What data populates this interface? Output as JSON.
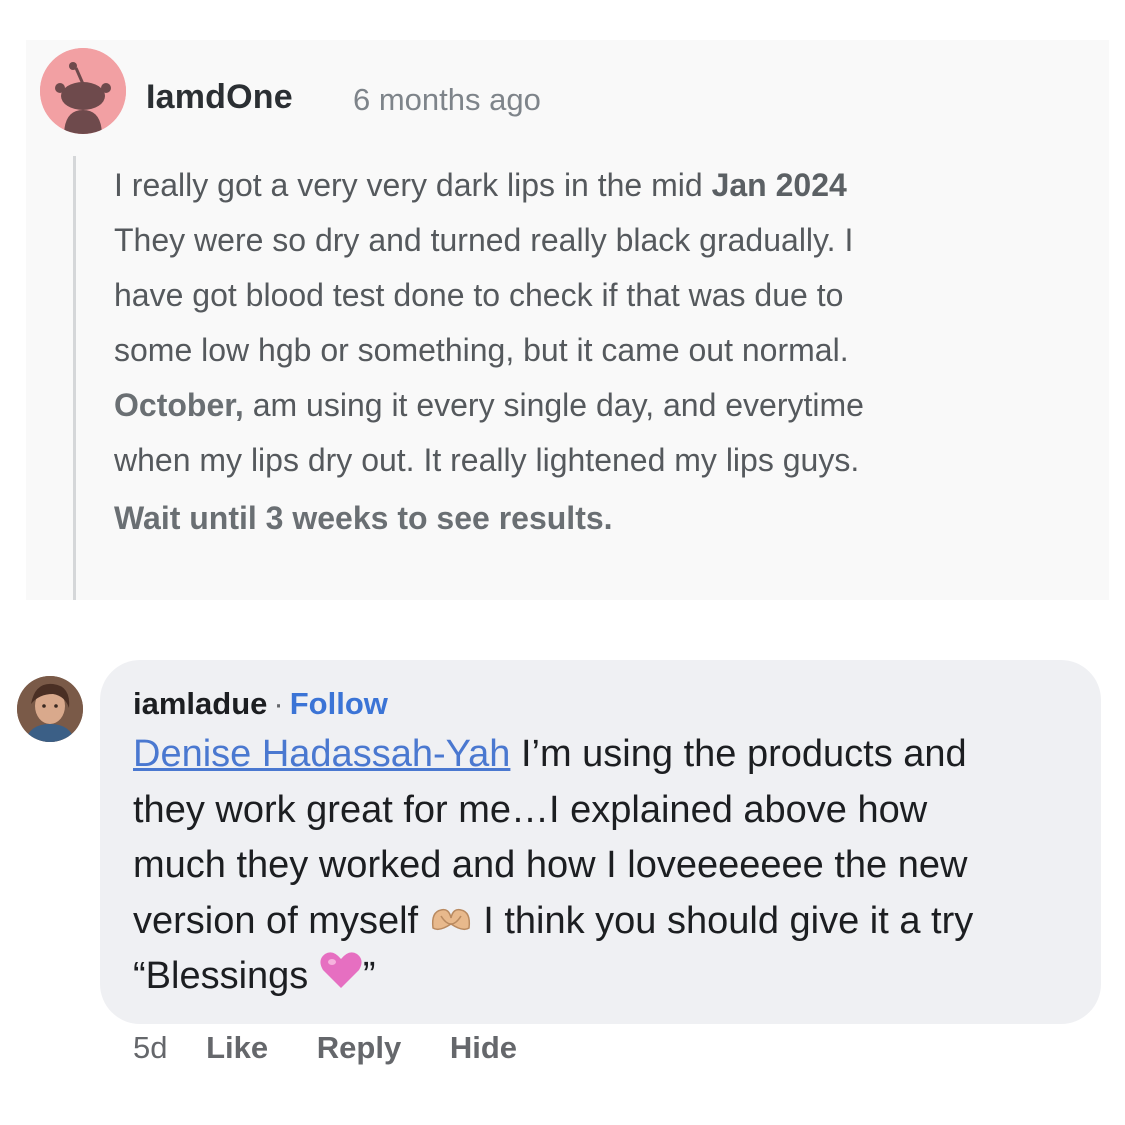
{
  "comment1": {
    "username": "IamdOne",
    "timestamp": "6 months ago",
    "lines": [
      "I really got a very very dark lips in the mid ",
      "They were so dry and turned really black gradually. I",
      "have got blood test done to check if that was due to",
      "some low hgb or something, but it came out normal.",
      " am using it every single day, and everytime",
      "when my lips dry out. It really lightened my lips guys.",
      "Wait until 3 weeks to see results."
    ],
    "date_overlay": "Jan 2024",
    "month_overlay": "October,",
    "avatar_icon": "reddit-snoo-avatar-icon",
    "colors": {
      "card_bg": "#f9f9f9",
      "avatar_bg": "#f2a0a3",
      "avatar_fg": "#6e4a4c"
    }
  },
  "comment2": {
    "username": "iamladue",
    "separator": "·",
    "follow_label": "Follow",
    "mention": "Denise Hadassah-Yah",
    "line1_rest": " I’m using the products and",
    "line2": "they work great for me…I explained above how",
    "line3": "much they worked and how I loveeeeeee the new",
    "line4_start": "version of myself ",
    "line4_end": " I think you should give it a try",
    "line5_start": "“Blessings ",
    "line5_end": "”",
    "emoji1": "heart-hands-emoji",
    "emoji2": "pink-heart-emoji",
    "time": "5d",
    "actions": [
      "Like",
      "Reply",
      "Hide"
    ],
    "colors": {
      "bubble_bg": "#eff0f3",
      "link": "#3b74d6"
    }
  }
}
